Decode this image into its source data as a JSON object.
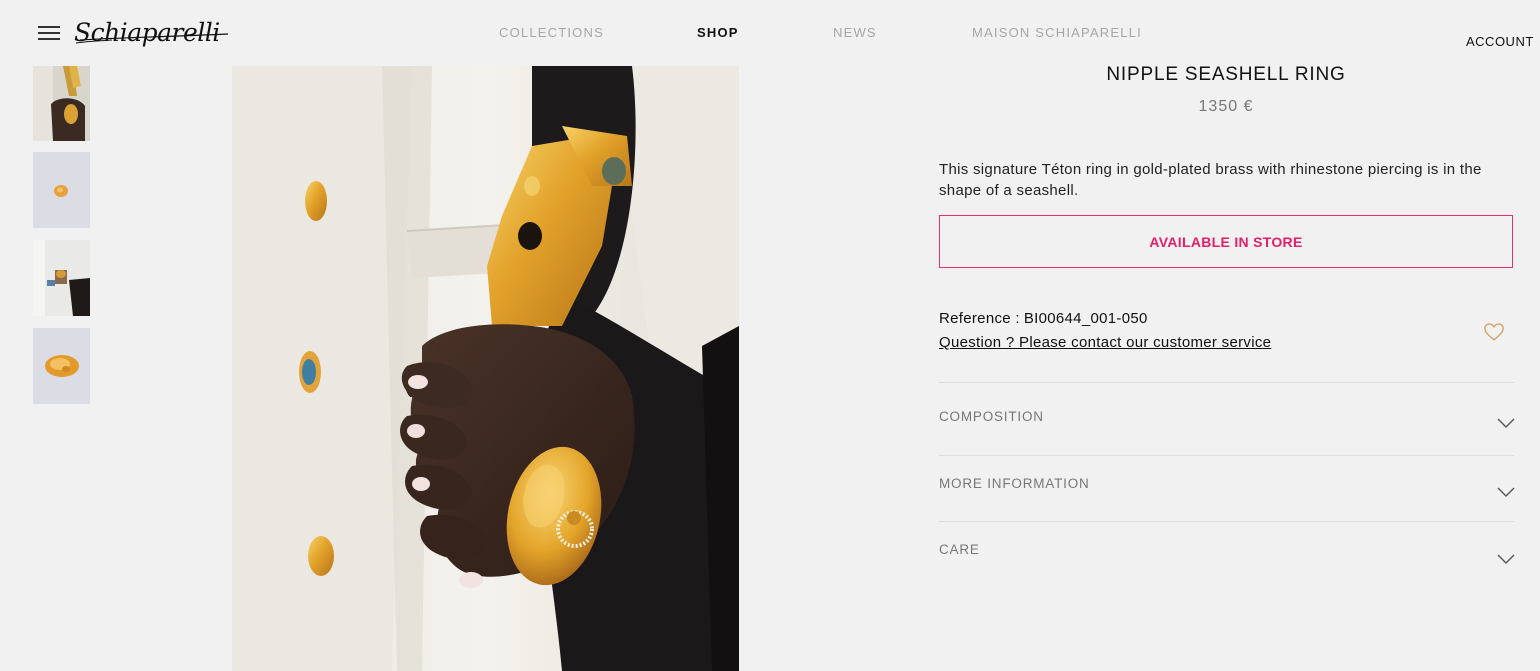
{
  "header": {
    "menu_icon": "hamburger-menu-icon",
    "logo_text": "Schiaparelli",
    "nav": [
      {
        "label": "COLLECTIONS",
        "active": false
      },
      {
        "label": "SHOP",
        "active": true
      },
      {
        "label": "NEWS",
        "active": false
      },
      {
        "label": "MAISON SCHIAPARELLI",
        "active": false
      }
    ],
    "account_label": "ACCOUNT"
  },
  "gallery": {
    "thumbnails": [
      {
        "alt": "ring-worn-on-hand-thumbnail"
      },
      {
        "alt": "ring-front-thumbnail"
      },
      {
        "alt": "ring-on-model-thumbnail"
      },
      {
        "alt": "ring-side-thumbnail"
      }
    ],
    "main_image": "model-wearing-nipple-seashell-ring"
  },
  "product": {
    "title": "NIPPLE SEASHELL RING",
    "price": "1350 €",
    "description": "This signature Téton ring in gold-plated brass with rhinestone piercing is in the shape of a seashell.",
    "availability_button": "AVAILABLE IN STORE",
    "reference_label": "Reference :",
    "reference_value": "BI00644_001-050",
    "question_link": "Question ? Please contact our customer service",
    "wishlist_icon": "heart-icon"
  },
  "accordions": [
    {
      "label": "COMPOSITION",
      "icon": "chevron-down-icon"
    },
    {
      "label": "MORE INFORMATION",
      "icon": "chevron-down-icon"
    },
    {
      "label": "CARE",
      "icon": "chevron-down-icon"
    }
  ],
  "colors": {
    "background": "#f1f1f1",
    "accent_pink": "#e41f6a",
    "nav_inactive": "#a6a6a6",
    "heart": "#d9a06a",
    "gold": "#e2a22a"
  }
}
